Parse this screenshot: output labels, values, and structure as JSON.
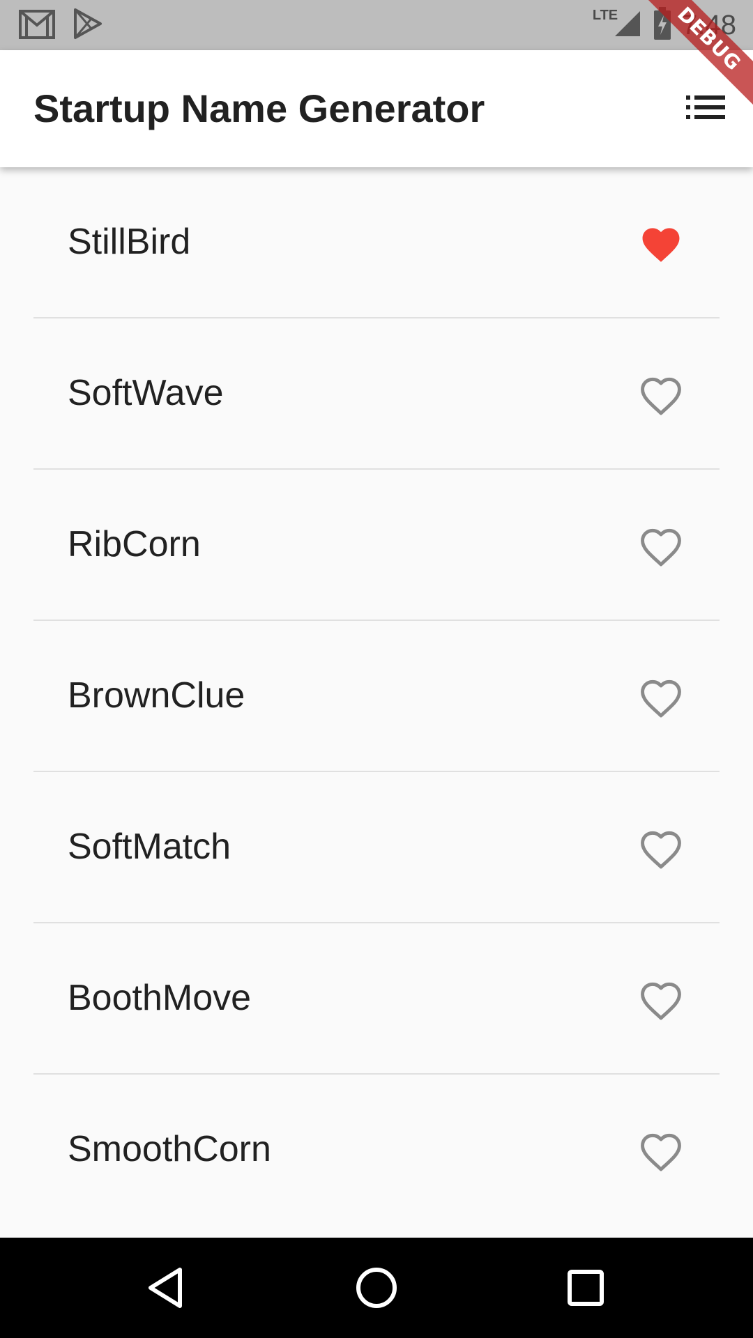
{
  "status_bar": {
    "time": "7:48",
    "network": "LTE",
    "icons": [
      "gmail-icon",
      "play-store-icon",
      "signal-icon",
      "battery-charging-icon"
    ]
  },
  "app_bar": {
    "title": "Startup Name Generator",
    "action_icon": "list-icon"
  },
  "debug_banner": "DEBUG",
  "list": {
    "items": [
      {
        "label": "StillBird",
        "saved": true
      },
      {
        "label": "SoftWave",
        "saved": false
      },
      {
        "label": "RibCorn",
        "saved": false
      },
      {
        "label": "BrownClue",
        "saved": false
      },
      {
        "label": "SoftMatch",
        "saved": false
      },
      {
        "label": "BoothMove",
        "saved": false
      },
      {
        "label": "SmoothCorn",
        "saved": false
      }
    ]
  },
  "colors": {
    "heart_saved": "#f44336",
    "heart_unsaved": "#8a8a8a",
    "status_bar": "#bdbdbd"
  },
  "nav_bar": {
    "icons": [
      "back-icon",
      "home-icon",
      "recents-icon"
    ]
  }
}
